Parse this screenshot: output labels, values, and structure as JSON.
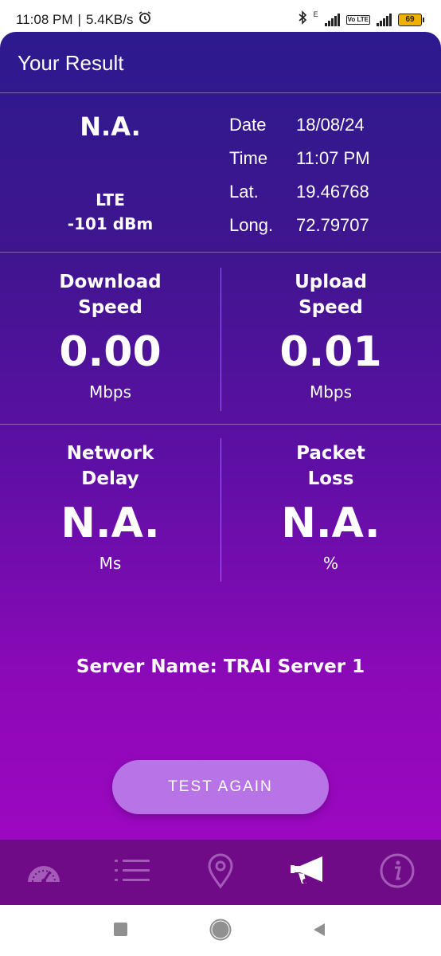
{
  "status_bar": {
    "time": "11:08 PM",
    "speed": "5.4KB/s",
    "network_label": "E",
    "volte": "Vo LTE",
    "battery": "69"
  },
  "header": {
    "title": "Your Result"
  },
  "summary": {
    "operator": "N.A.",
    "technology": "LTE",
    "signal": "-101 dBm",
    "date_label": "Date",
    "date_value": "18/08/24",
    "time_label": "Time",
    "time_value": "11:07 PM",
    "lat_label": "Lat.",
    "lat_value": "19.46768",
    "long_label": "Long.",
    "long_value": "72.79707"
  },
  "download": {
    "label_line1": "Download",
    "label_line2": "Speed",
    "value": "0.00",
    "unit": "Mbps"
  },
  "upload": {
    "label_line1": "Upload",
    "label_line2": "Speed",
    "value": "0.01",
    "unit": "Mbps"
  },
  "delay": {
    "label_line1": "Network",
    "label_line2": "Delay",
    "value": "N.A.",
    "unit": "Ms"
  },
  "loss": {
    "label_line1": "Packet",
    "label_line2": "Loss",
    "value": "N.A.",
    "unit": "%"
  },
  "server": {
    "text": "Server Name: TRAI Server 1"
  },
  "actions": {
    "test_again": "TEST AGAIN"
  },
  "nav": {
    "items": [
      {
        "icon": "speedometer-icon",
        "active": false
      },
      {
        "icon": "list-icon",
        "active": false
      },
      {
        "icon": "location-pin-icon",
        "active": false
      },
      {
        "icon": "megaphone-icon",
        "active": true
      },
      {
        "icon": "info-icon",
        "active": false
      }
    ]
  },
  "colors": {
    "gradient_top": "#2c1a8e",
    "gradient_bottom": "#a307c3",
    "button": "#b874e6",
    "navbar": "#700b88"
  }
}
